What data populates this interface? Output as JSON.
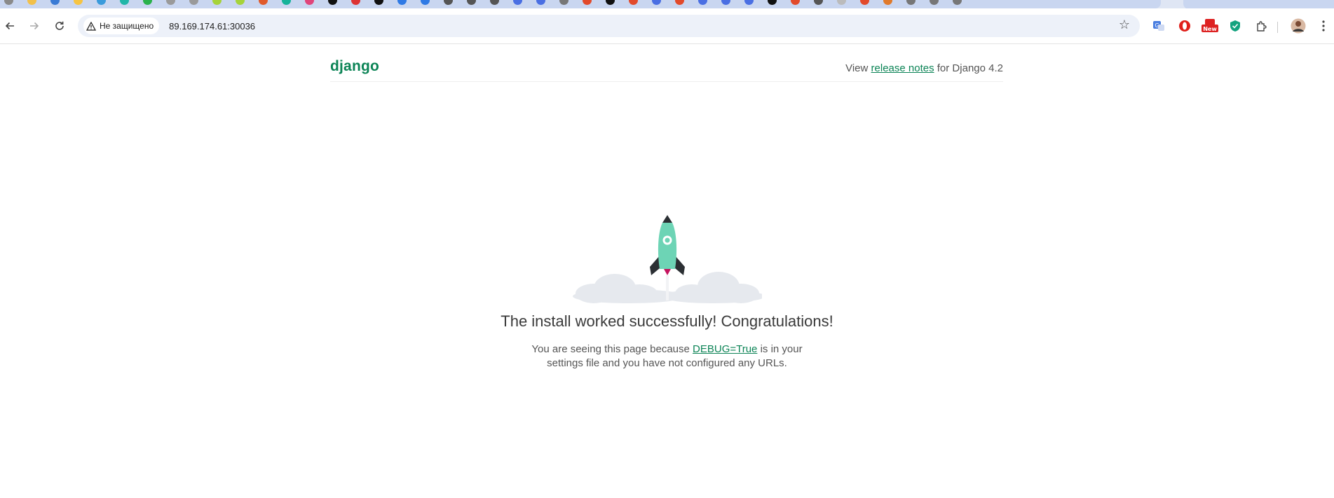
{
  "browser": {
    "security_label": "Не защищено",
    "url": "89.169.174.61:30036",
    "new_badge": "New",
    "colors": {
      "omnibox_bg": "#edf1f9",
      "tabstrip_bg": "#dfe6f4"
    },
    "icons": {
      "back": "back-arrow-icon",
      "forward": "forward-arrow-icon",
      "reload": "reload-icon",
      "security": "warning-triangle-icon",
      "bookmark": "star-icon",
      "extensions": [
        "translate-icon",
        "opera-icon",
        "new-badge-icon",
        "shield-icon",
        "puzzle-icon"
      ],
      "profile": "avatar",
      "menu": "kebab-menu-icon"
    }
  },
  "page": {
    "logo": "django",
    "release_prefix": "View ",
    "release_link": "release notes",
    "release_suffix": " for Django 4.2",
    "title": "The install worked successfully! Congratulations!",
    "sub_prefix": "You are seeing this page because ",
    "sub_link": "DEBUG=True",
    "sub_suffix_1": " is in your",
    "sub_line_2": "settings file and you have not configured any URLs.",
    "colors": {
      "brand": "#0c8456",
      "rocket": "#6dd4b5",
      "cloud": "#e6e9ee"
    }
  }
}
